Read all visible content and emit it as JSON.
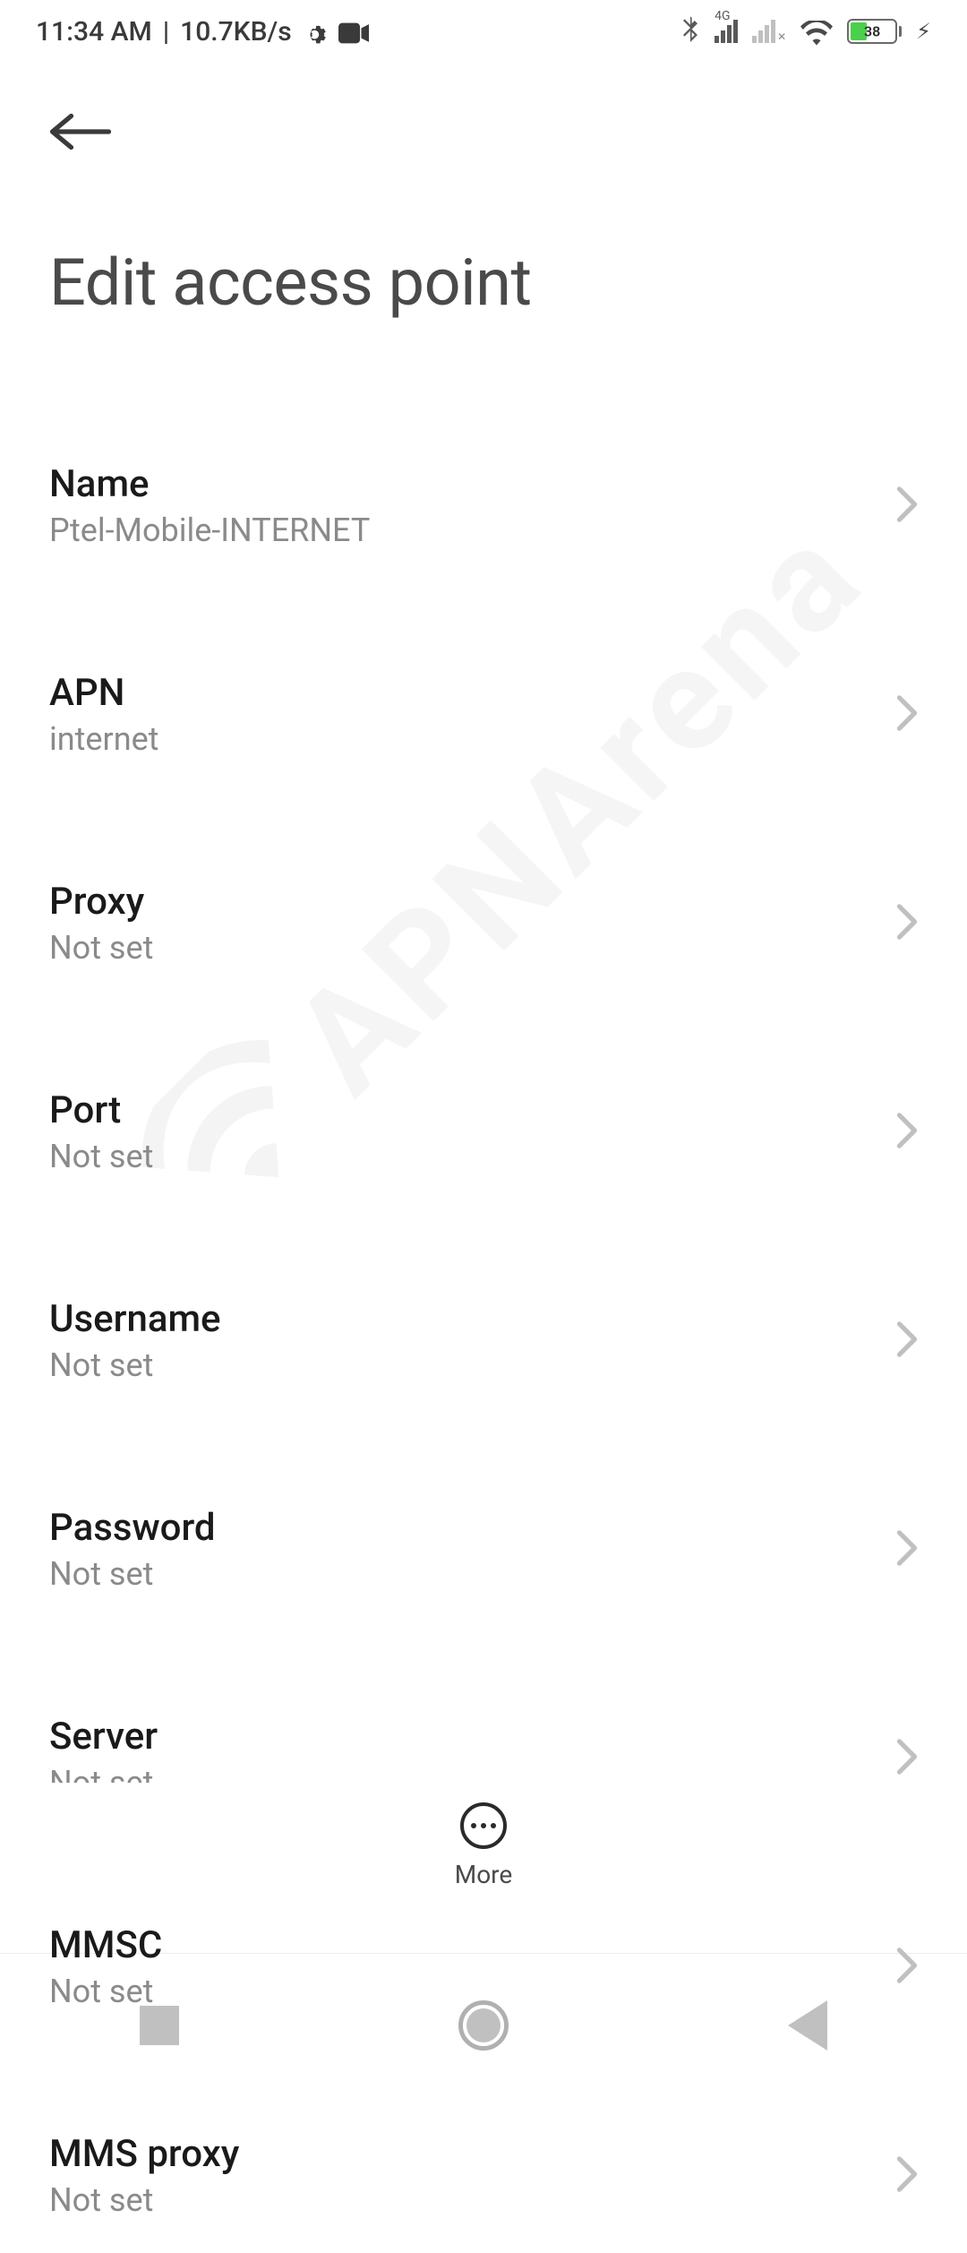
{
  "status": {
    "time": "11:34 AM",
    "transfer": "10.7KB/s",
    "network_type": "4G",
    "battery_pct": "38"
  },
  "page": {
    "title": "Edit access point"
  },
  "settings": [
    {
      "label": "Name",
      "value": "Ptel-Mobile-INTERNET"
    },
    {
      "label": "APN",
      "value": "internet"
    },
    {
      "label": "Proxy",
      "value": "Not set"
    },
    {
      "label": "Port",
      "value": "Not set"
    },
    {
      "label": "Username",
      "value": "Not set"
    },
    {
      "label": "Password",
      "value": "Not set"
    },
    {
      "label": "Server",
      "value": "Not set"
    },
    {
      "label": "MMSC",
      "value": "Not set"
    },
    {
      "label": "MMS proxy",
      "value": "Not set"
    }
  ],
  "footer": {
    "more": "More"
  },
  "watermark": "APNArena"
}
